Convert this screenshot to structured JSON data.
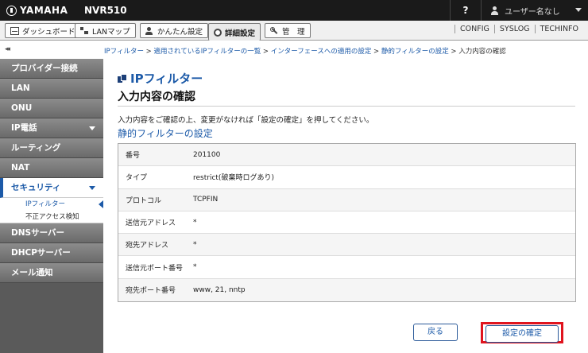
{
  "topbar": {
    "brand": "YAMAHA",
    "model": "NVR510",
    "help": "?",
    "user": "ユーザー名なし"
  },
  "tabs": [
    {
      "label": "ダッシュボード",
      "icon": "dashboard-icon"
    },
    {
      "label": "LANマップ",
      "icon": "lan-map-icon"
    },
    {
      "label": "かんたん設定",
      "icon": "wizard-icon"
    },
    {
      "label": "詳細設定",
      "icon": "gear-icon",
      "active": true
    },
    {
      "label": "管　理",
      "icon": "tool-icon"
    }
  ],
  "links": [
    "CONFIG",
    "SYSLOG",
    "TECHINFO"
  ],
  "collapse": "◂◂",
  "breadcrumb": {
    "items": [
      "IPフィルター",
      "適用されているIPフィルターの一覧",
      "インターフェースへの適用の設定",
      "静的フィルターの設定"
    ],
    "separator": " > ",
    "current": "入力内容の確認"
  },
  "sidebar": {
    "items": [
      {
        "label": "プロバイダー接続"
      },
      {
        "label": "LAN"
      },
      {
        "label": "ONU"
      },
      {
        "label": "IP電話"
      },
      {
        "label": "ルーティング"
      },
      {
        "label": "NAT"
      },
      {
        "label": "セキュリティ"
      },
      {
        "label": "DNSサーバー"
      },
      {
        "label": "DHCPサーバー"
      },
      {
        "label": "メール通知"
      }
    ],
    "sub_items": [
      "IPフィルター",
      "不正アクセス検知"
    ]
  },
  "main": {
    "category": "IPフィルター",
    "title": "入力内容の確認",
    "instruction": "入力内容をご確認の上、変更がなければ「設定の確定」を押してください。",
    "section": "静的フィルターの設定",
    "rows": [
      {
        "label": "番号",
        "value": "201100"
      },
      {
        "label": "タイプ",
        "value": "restrict(破棄時ログあり)"
      },
      {
        "label": "プロトコル",
        "value": "TCPFIN"
      },
      {
        "label": "送信元アドレス",
        "value": "*"
      },
      {
        "label": "宛先アドレス",
        "value": "*"
      },
      {
        "label": "送信元ポート番号",
        "value": "*"
      },
      {
        "label": "宛先ポート番号",
        "value": "www, 21, nntp"
      }
    ],
    "back_label": "戻る",
    "confirm_label": "設定の確定"
  },
  "colors": {
    "accent": "#1c5aa8",
    "highlight": "#e0141e",
    "topbar": "#1a1a1a"
  }
}
